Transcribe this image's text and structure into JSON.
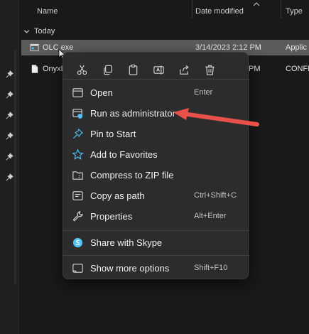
{
  "columns": {
    "name": "Name",
    "date_modified": "Date modified",
    "type": "Type"
  },
  "group": {
    "label": "Today"
  },
  "files": [
    {
      "name": "OLC.exe",
      "date": "3/14/2023 2:12 PM",
      "type": "Applic",
      "selected": true,
      "icon": "exe-icon"
    },
    {
      "name": "OnyxL",
      "date": "PM",
      "type": "CONFIG",
      "selected": false,
      "icon": "config-file-icon"
    }
  ],
  "context_menu": {
    "toolbar": [
      {
        "name": "cut-icon",
        "label": ""
      },
      {
        "name": "copy-icon",
        "label": ""
      },
      {
        "name": "paste-icon",
        "label": ""
      },
      {
        "name": "rename-icon",
        "label": ""
      },
      {
        "name": "share-icon",
        "label": ""
      },
      {
        "name": "delete-icon",
        "label": ""
      }
    ],
    "items": [
      {
        "label": "Open",
        "accel": "Enter",
        "icon": "open-icon"
      },
      {
        "label": "Run as administrator",
        "accel": "",
        "icon": "run-as-admin-icon"
      },
      {
        "label": "Pin to Start",
        "accel": "",
        "icon": "pin-icon"
      },
      {
        "label": "Add to Favorites",
        "accel": "",
        "icon": "star-icon"
      },
      {
        "label": "Compress to ZIP file",
        "accel": "",
        "icon": "zip-folder-icon"
      },
      {
        "label": "Copy as path",
        "accel": "Ctrl+Shift+C",
        "icon": "copy-path-icon"
      },
      {
        "label": "Properties",
        "accel": "Alt+Enter",
        "icon": "wrench-icon"
      },
      {
        "label": "Share with Skype",
        "accel": "",
        "icon": "skype-icon"
      },
      {
        "label": "Show more options",
        "accel": "Shift+F10",
        "icon": "more-options-icon"
      }
    ]
  },
  "annotation": {
    "arrow_color": "#e8504a",
    "points_to": "Run as administrator"
  },
  "colors": {
    "accent": "#4cc2ff",
    "selection": "#5b5b5b",
    "menu_bg": "#2c2c2c"
  }
}
